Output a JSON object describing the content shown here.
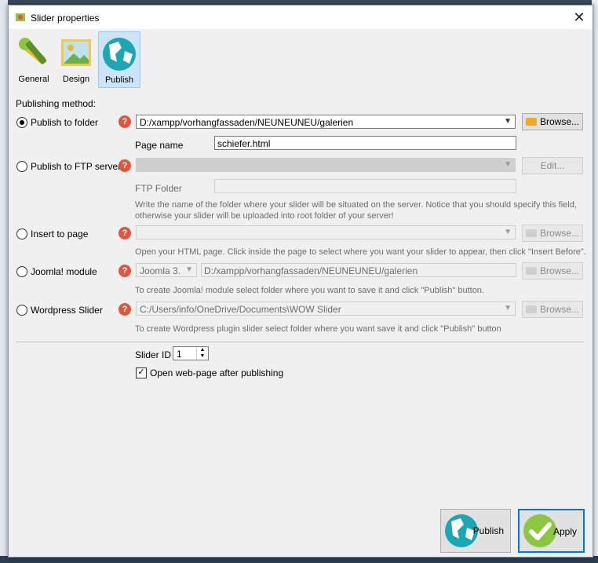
{
  "window": {
    "title": "Slider properties",
    "close": "✕"
  },
  "toolbar": [
    {
      "label": "General",
      "active": false
    },
    {
      "label": "Design",
      "active": false
    },
    {
      "label": "Publish",
      "active": true
    }
  ],
  "publishing_method_label": "Publishing method:",
  "folder": {
    "label": "Publish to folder",
    "selected": true,
    "path": "D:/xampp/vorhangfassaden/NEUNEUNEU/galerien",
    "browse": "Browse...",
    "page_name_label": "Page name",
    "page_name": "schiefer.html"
  },
  "ftp": {
    "label": "Publish to FTP server",
    "selected": false,
    "server": "",
    "edit": "Edit...",
    "folder_label": "FTP Folder",
    "folder": "",
    "hint": "Write the name of the folder where your slider will be situated on the server. Notice that you should specify this field, otherwise your slider will be uploaded into root folder of your server!"
  },
  "insert": {
    "label": "Insert to page",
    "selected": false,
    "page": "",
    "browse": "Browse...",
    "hint": "Open your HTML page. Click inside the page to select where you want your slider to appear, then click \"Insert Before\"."
  },
  "joomla": {
    "label": "Joomla! module",
    "selected": false,
    "version": "Joomla 3.x",
    "path": "D:/xampp/vorhangfassaden/NEUNEUNEU/galerien",
    "browse": "Browse...",
    "hint": "To create Joomla! module select folder where you want to save it and click \"Publish\" button."
  },
  "wordpress": {
    "label": "Wordpress Slider",
    "selected": false,
    "path": "C:/Users/info/OneDrive/Documents\\WOW Slider",
    "browse": "Browse...",
    "hint": "To create Wordpress plugin slider select folder where you want save it and click \"Publish\" button"
  },
  "help_glyph": "?",
  "slider_id": {
    "label": "Slider ID",
    "value": "1"
  },
  "open_after": {
    "label": "Open web-page after publishing",
    "checked": true,
    "mark": "✓"
  },
  "buttons": {
    "publish": "Publish",
    "apply": "Apply"
  },
  "colors": {
    "accent": "#0078d7",
    "help": "#e0553b",
    "globe": "#1ba6b4",
    "check": "#8dc63f"
  }
}
